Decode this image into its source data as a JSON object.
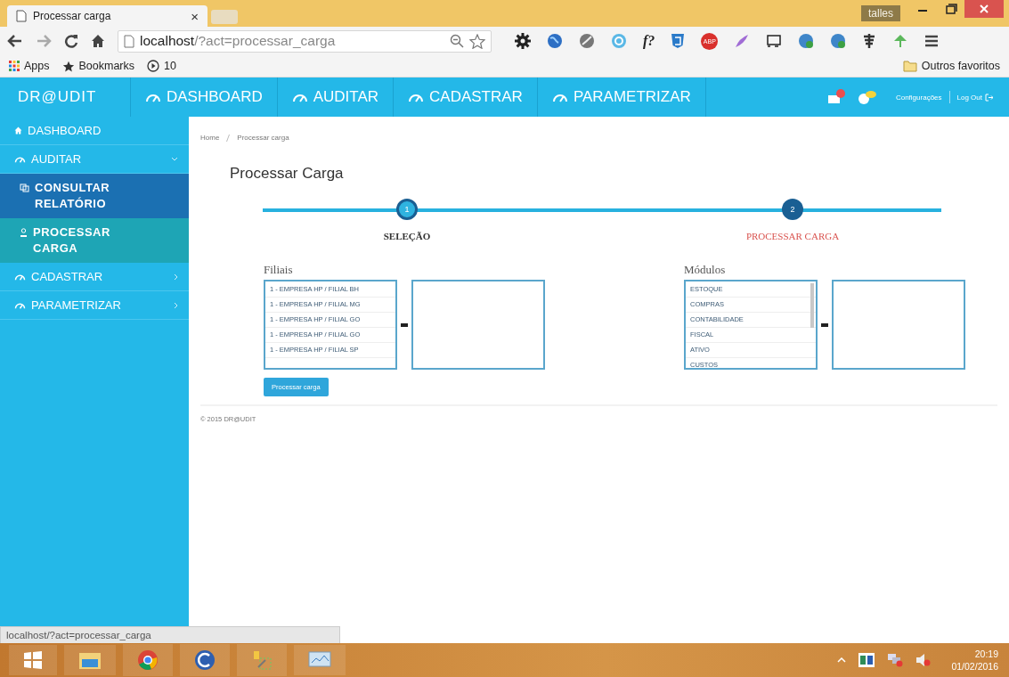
{
  "browser": {
    "tab_title": "Processar carga",
    "tab_close": "×",
    "user": "talles",
    "url_host": "localhost",
    "url_path": "/?act=processar_carga",
    "extension_labels": {
      "formula": "f?",
      "adblock": "ABP"
    },
    "bookmarks": [
      {
        "label": "Apps",
        "kind": "apps"
      },
      {
        "label": "Bookmarks",
        "kind": "star"
      },
      {
        "label": "10",
        "kind": "play"
      }
    ],
    "other_bookmarks": "Outros favoritos"
  },
  "app": {
    "brand": "DR@UDIT",
    "nav": [
      {
        "label": "DASHBOARD"
      },
      {
        "label": "AUDITAR"
      },
      {
        "label": "CADASTRAR"
      },
      {
        "label": "PARAMETRIZAR"
      }
    ],
    "settings": "Configurações",
    "logout": "Log Out"
  },
  "sidebar": {
    "items": [
      {
        "label": "DASHBOARD",
        "kind": "home",
        "selected": false
      },
      {
        "label": "AUDITAR",
        "kind": "gauge",
        "selected": false,
        "expanded": true,
        "children": [
          {
            "label": "CONSULTAR RELATÓRIO",
            "kind": "reports",
            "selected": false,
            "hovered": true
          },
          {
            "label": "PROCESSAR CARGA",
            "kind": "person",
            "selected": true,
            "hovered": false
          }
        ]
      },
      {
        "label": "CADASTRAR",
        "kind": "gauge",
        "selected": false,
        "expanded": false
      },
      {
        "label": "PARAMETRIZAR",
        "kind": "gauge",
        "selected": false,
        "expanded": false
      }
    ]
  },
  "breadcrumb": [
    "Home",
    "Processar carga"
  ],
  "page_title": "Processar Carga",
  "steps": [
    {
      "number": "1",
      "label": "SELEÇÃO",
      "active": true
    },
    {
      "number": "2",
      "label": "PROCESSAR CARGA",
      "active": false
    }
  ],
  "pickers": [
    {
      "label": "Filiais",
      "items": [
        "1 - EMPRESA HP / FILIAL BH",
        "1 - EMPRESA HP / FILIAL MG",
        "1 - EMPRESA HP / FILIAL GO",
        "1 - EMPRESA HP / FILIAL GO",
        "1 - EMPRESA HP / FILIAL SP"
      ]
    },
    {
      "label": "Módulos",
      "items": [
        "ESTOQUE",
        "COMPRAS",
        "CONTABILIDADE",
        "FISCAL",
        "ATIVO",
        "CUSTOS"
      ]
    }
  ],
  "submit_button": "Processar carga",
  "footer": "© 2015 DR@UDIT",
  "status_url": "localhost/?act=processar_carga",
  "taskbar": {
    "time": "20:19",
    "date": "01/02/2016"
  }
}
